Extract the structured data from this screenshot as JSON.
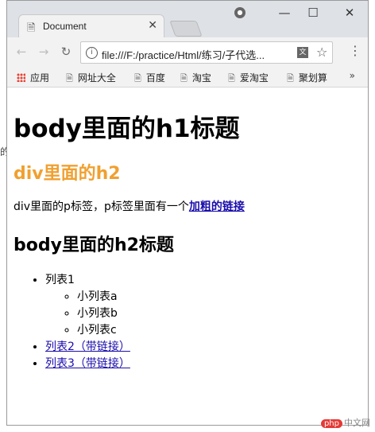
{
  "tab": {
    "title": "Document"
  },
  "addressbar": {
    "url": "file:///F:/practice/Html/练习/子代选..."
  },
  "bookmarks": {
    "items": [
      {
        "label": "应用"
      },
      {
        "label": "网址大全"
      },
      {
        "label": "百度"
      },
      {
        "label": "淘宝"
      },
      {
        "label": "爱淘宝"
      },
      {
        "label": "聚划算"
      }
    ],
    "more": "»"
  },
  "page": {
    "h1": "body里面的h1标题",
    "div_h2": "div里面的h2",
    "div_p_text": "div里面的p标签，p标签里面有一个",
    "div_p_link": "加粗的链接",
    "body_h2": "body里面的h2标题",
    "list": {
      "item1": "列表1",
      "sub_items": [
        "小列表a",
        "小列表b",
        "小列表c"
      ],
      "item2": "列表2（带链接）",
      "item3": "列表3（带链接）"
    }
  },
  "side_text": "的",
  "watermark": {
    "logo": "php",
    "text": "中文网"
  },
  "colors": {
    "div_h2": "#f0a030",
    "link": "#1a0dab",
    "titlebar": "#dee1e6"
  }
}
